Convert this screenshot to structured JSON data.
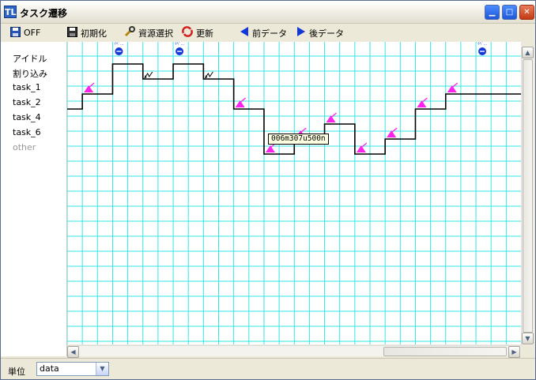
{
  "window": {
    "title": "タスク遷移",
    "app_icon": "TL"
  },
  "toolbar": {
    "off_label": "OFF",
    "init_label": "初期化",
    "resource_label": "資源選択",
    "refresh_label": "更新",
    "prev_label": "前データ",
    "next_label": "後データ"
  },
  "rows": [
    "アイドル",
    "割り込み",
    "task_1",
    "task_2",
    "task_4",
    "task_6",
    "other"
  ],
  "colors": {
    "grid": "#33e6e6",
    "trace": "#000000",
    "event_pink": "#ff22ee",
    "event_blue": "#1438d8",
    "label_gray": "#999999"
  },
  "tooltip": {
    "text": "006m307u500n"
  },
  "status": {
    "unit_label": "単位",
    "unit_value": "data"
  },
  "events": {
    "blue_marker_caption": "ｲﾍﾞ..."
  },
  "timeline": {
    "steps": [
      {
        "row": 3,
        "t0": 0,
        "t1": 1
      },
      {
        "row": 2,
        "t0": 1,
        "t1": 3
      },
      {
        "row": 0,
        "t0": 3,
        "t1": 5
      },
      {
        "row": 1,
        "t0": 5,
        "t1": 7
      },
      {
        "row": 0,
        "t0": 7,
        "t1": 9
      },
      {
        "row": 1,
        "t0": 9,
        "t1": 11
      },
      {
        "row": 3,
        "t0": 11,
        "t1": 13
      },
      {
        "row": 6,
        "t0": 13,
        "t1": 15
      },
      {
        "row": 5,
        "t0": 15,
        "t1": 17
      },
      {
        "row": 4,
        "t0": 17,
        "t1": 19
      },
      {
        "row": 6,
        "t0": 19,
        "t1": 21
      },
      {
        "row": 5,
        "t0": 21,
        "t1": 23
      },
      {
        "row": 3,
        "t0": 23,
        "t1": 25
      },
      {
        "row": 2,
        "t0": 25,
        "t1": 27
      },
      {
        "row": 2,
        "t0": 27,
        "t1": 30
      }
    ],
    "pink_events": [
      1,
      11,
      13,
      15,
      17,
      19,
      21,
      23,
      25
    ],
    "blue_events": [
      3,
      7,
      27
    ],
    "switch_events": [
      5,
      9
    ]
  }
}
